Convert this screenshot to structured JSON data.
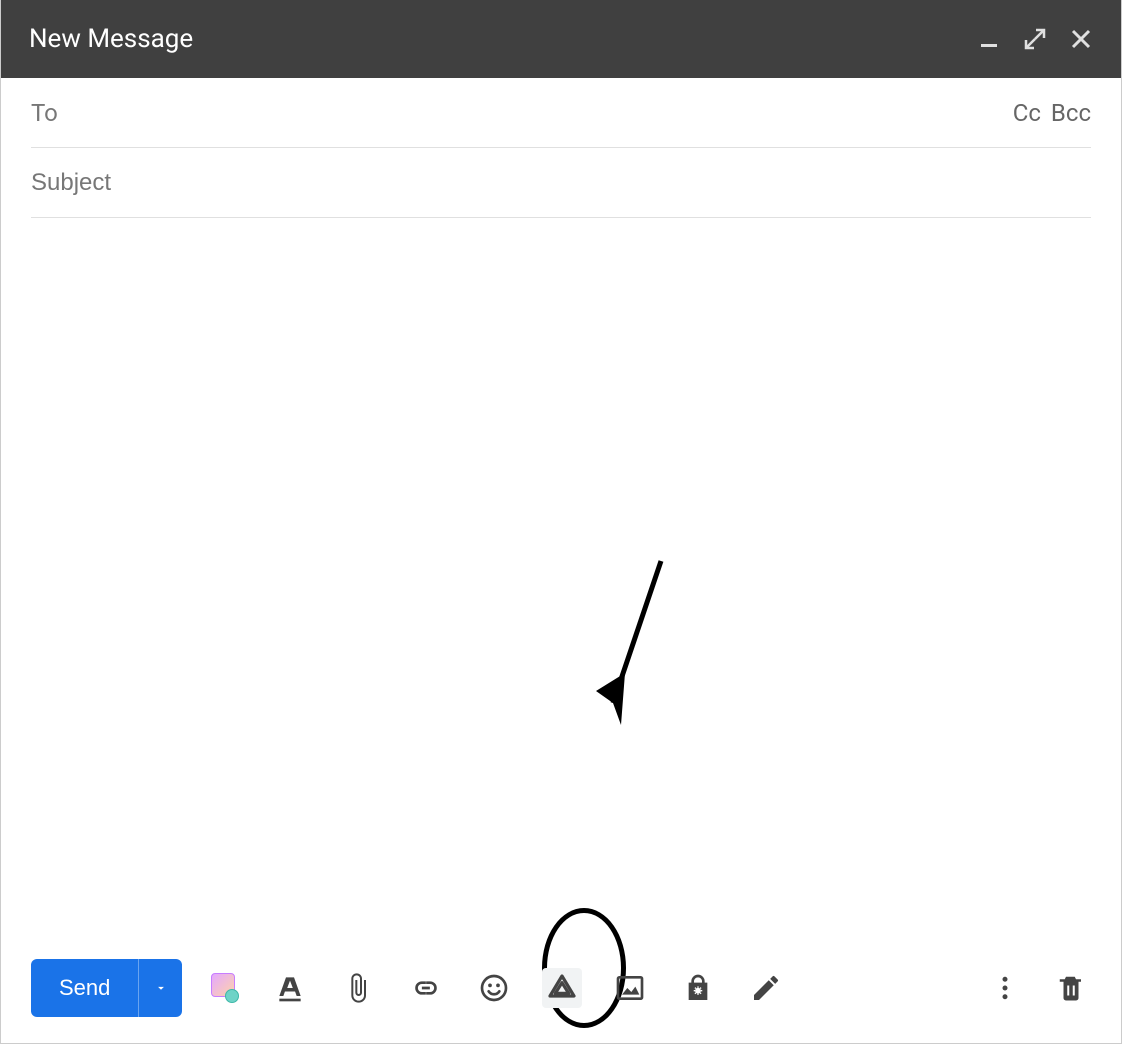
{
  "header": {
    "title": "New Message",
    "controls": {
      "minimize": "minimize-icon",
      "expand": "expand-icon",
      "close": "close-icon"
    }
  },
  "fields": {
    "to": {
      "label": "To",
      "value": ""
    },
    "cc_label": "Cc",
    "bcc_label": "Bcc",
    "subject": {
      "placeholder": "Subject",
      "value": ""
    }
  },
  "body": {
    "value": ""
  },
  "toolbar": {
    "send_label": "Send",
    "icons": {
      "addons": "addons-icon",
      "format": "text-format-icon",
      "attach": "attach-file-icon",
      "link": "insert-link-icon",
      "emoji": "emoji-icon",
      "drive": "drive-icon",
      "image": "insert-photo-icon",
      "confidential": "confidential-mode-icon",
      "signature": "signature-icon",
      "more": "more-options-icon",
      "discard": "discard-draft-icon"
    }
  },
  "colors": {
    "primary": "#1a73e8",
    "header_bg": "#404040"
  }
}
